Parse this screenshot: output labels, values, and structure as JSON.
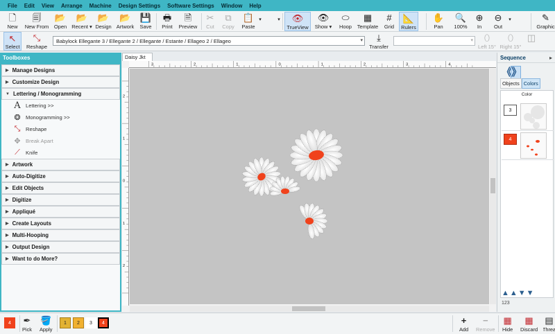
{
  "menu": [
    "File",
    "Edit",
    "View",
    "Arrange",
    "Machine",
    "Design Settings",
    "Software Settings",
    "Window",
    "Help"
  ],
  "toolbar": {
    "new": "New",
    "new_from": "New From",
    "open": "Open",
    "recent": "Recent",
    "design": "Design",
    "artwork": "Artwork",
    "save": "Save",
    "print": "Print",
    "preview": "Preview",
    "cut": "Cut",
    "copy": "Copy",
    "paste": "Paste",
    "trueview": "TrueView",
    "show": "Show",
    "hoop": "Hoop",
    "template": "Template",
    "grid": "Grid",
    "rulers": "Rulers",
    "pan": "Pan",
    "zoom100": "100%",
    "zoom_in": "In",
    "zoom_out": "Out",
    "graphics": "Graphic"
  },
  "toolbar2": {
    "select": "Select",
    "reshape": "Reshape",
    "path": "Babylock Ellegante 3 / Ellegante 2 / Ellegante / Estante / Ellageo 2 / Ellageo",
    "transfer": "Transfer",
    "left": "Left 15°",
    "right": "Right 15°"
  },
  "toolboxes": {
    "title": "Toolboxes",
    "categories": [
      {
        "label": "Manage Designs",
        "open": false
      },
      {
        "label": "Customize Design",
        "open": false
      },
      {
        "label": "Lettering / Monogramming",
        "open": true
      },
      {
        "label": "Artwork",
        "open": false
      },
      {
        "label": "Auto-Digitize",
        "open": false
      },
      {
        "label": "Edit Objects",
        "open": false
      },
      {
        "label": "Digitize",
        "open": false
      },
      {
        "label": "Appliqué",
        "open": false
      },
      {
        "label": "Create Layouts",
        "open": false
      },
      {
        "label": "Multi-Hooping",
        "open": false
      },
      {
        "label": "Output Design",
        "open": false
      },
      {
        "label": "Want to do More?",
        "open": false
      }
    ],
    "lettering_items": [
      {
        "label": "Lettering >>",
        "enabled": true
      },
      {
        "label": "Monogramming >>",
        "enabled": true
      },
      {
        "label": "Reshape",
        "enabled": true
      },
      {
        "label": "Break Apart",
        "enabled": false
      },
      {
        "label": "Knife",
        "enabled": true
      }
    ]
  },
  "document": {
    "tab": "Daisy Jkt",
    "close": "×"
  },
  "rulers": {
    "top": [
      "3",
      "2",
      "1",
      "0",
      "1",
      "2",
      "3",
      "4"
    ],
    "left": [
      "2",
      "1",
      "0",
      "1",
      "2"
    ]
  },
  "sequence": {
    "title": "Sequence",
    "tabs": [
      "Objects",
      "Colors"
    ],
    "active_tab": "Colors",
    "column": "Color",
    "rows": [
      {
        "num": "3",
        "color": "#ffffff"
      },
      {
        "num": "4",
        "color": "#f0421c"
      }
    ],
    "bottom_count": "123"
  },
  "bottom": {
    "swatches": [
      {
        "num": "4",
        "color": "#f0421c"
      },
      {
        "num": "1",
        "color": "#e2b233"
      },
      {
        "num": "2",
        "color": "#f1b131"
      },
      {
        "num": "3",
        "color": "#ffffff"
      },
      {
        "num": "4",
        "color": "#f0421c"
      }
    ],
    "pick": "Pick",
    "apply": "Apply",
    "add": "Add",
    "remove": "Remove",
    "hide": "Hide",
    "discard": "Discard",
    "threads": "Threa"
  },
  "colors": {
    "accent": "#3fb6c5",
    "thread_red": "#f0421c",
    "thread_white": "#ffffff",
    "canvas": "#c4c4c4"
  }
}
